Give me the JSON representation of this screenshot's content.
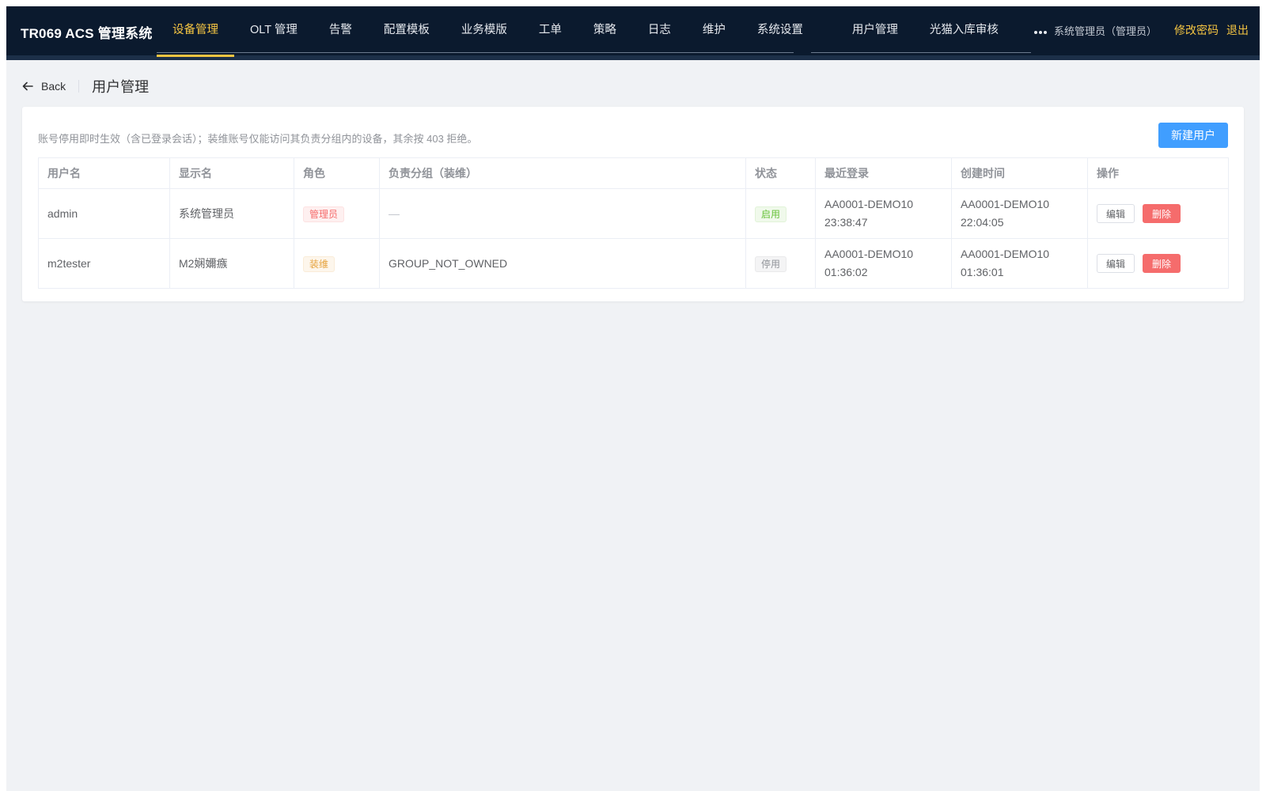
{
  "header": {
    "brand": "TR069 ACS 管理系统",
    "nav": [
      {
        "label": "设备管理",
        "active": true
      },
      {
        "label": "OLT 管理"
      },
      {
        "label": "告警"
      },
      {
        "label": "配置模板"
      },
      {
        "label": "业务模版"
      },
      {
        "label": "工单"
      },
      {
        "label": "策略"
      },
      {
        "label": "日志"
      },
      {
        "label": "维护"
      },
      {
        "label": "系统设置"
      },
      {
        "label": "用户管理"
      },
      {
        "label": "光猫入库审核"
      }
    ],
    "more_icon": "ellipsis-icon",
    "user_name": "系统管理员（管理员）",
    "change_password": "修改密码",
    "logout": "退出"
  },
  "page": {
    "back_label": "Back",
    "back_icon": "arrow-left-icon",
    "title": "用户管理"
  },
  "card": {
    "hint": "账号停用即时生效（含已登录会话）；装维账号仅能访问其负责分组内的设备，其余按 403 拒绝。",
    "new_user_label": "新建用户"
  },
  "table": {
    "columns": [
      "用户名",
      "显示名",
      "角色",
      "负责分组（装维）",
      "状态",
      "最近登录",
      "创建时间",
      "操作"
    ],
    "rows": [
      {
        "username": "admin",
        "display_name": "系统管理员",
        "role": "管理员",
        "group": "—",
        "status": "启用",
        "last_login_line1": "AA0001-DEMO10",
        "last_login_line2": "23:38:47",
        "created_line1": "AA0001-DEMO10",
        "created_line2": "22:04:05",
        "edit_label": "编辑",
        "delete_label": "删除"
      },
      {
        "username": "m2tester",
        "display_name": "M2娴嬭瘯",
        "role": "装维",
        "group": "GROUP_NOT_OWNED",
        "status": "停用",
        "last_login_line1": "AA0001-DEMO10",
        "last_login_line2": "01:36:02",
        "created_line1": "AA0001-DEMO10",
        "created_line2": "01:36:01",
        "edit_label": "编辑",
        "delete_label": "删除"
      }
    ]
  },
  "colors": {
    "header_bg": "#0b1a2e",
    "accent": "#f5c542",
    "primary": "#409eff",
    "danger": "#f56c6c",
    "page_bg": "#f0f2f5"
  }
}
